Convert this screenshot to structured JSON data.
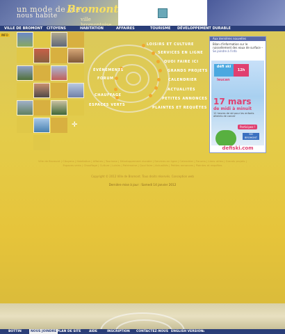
{
  "header": {
    "tagline_line1": "un mode de vie",
    "tagline_line2": "nous habite",
    "brand": "Bromont",
    "brand_sub": "ville   bromontoise"
  },
  "top_nav": [
    "Ville de Bromont",
    "Citoyens",
    "Habitation",
    "Affaires",
    "Tourisme",
    "Développement durable"
  ],
  "info_tag": "INFO",
  "spiral_menu": [
    "Loisirs et culture",
    "Services en ligne",
    "Quoi faire ici",
    "Grands projets",
    "Calendrier",
    "Actualités",
    "Petites annonces",
    "Plaintes et requêtes",
    "Espaces verts",
    "Chauffage",
    "Forum",
    "Événements"
  ],
  "ad_panel": {
    "header": "Aux dernières nouvelles",
    "news_text": "Bilan d'information sur le ruissellement des eaux de surface",
    "news_link": "Se joindre à l'info",
    "logo_left": "défi ski",
    "logo_right": "12h",
    "logo_brand": "leucan",
    "date": "17 mars",
    "sub": "de midi à minuit",
    "desc": "12 heures de ski pour les enfants atteints de cancer",
    "cta": "Participez !",
    "town": "SKI BROMONT",
    "footer": "defiski.com"
  },
  "footer_links": "Ville de Bromont | Citoyens | Habitation | Affaires | Tourisme | Développement durable | Services en ligne | Calendrier | Forums | Liens utiles | Grands projets | Espaces verts | Chauffage | Culture | Loisirs | Patrimoine | Quoi faire | Actualités | Petites annonces | Plaintes et requêtes",
  "credits": "Copyright © 2012 Ville de Bromont. Tous droits réservés. Conception web",
  "updated": "Dernière mise à jour : Samedi 14 janvier 2012",
  "bottom_nav": [
    "Bottin",
    "Nous joindre",
    "Plan de site",
    "Aide",
    "Inscription",
    "Contactez-nous",
    "English version"
  ],
  "colors": {
    "nav_bg": "#2a3e78",
    "accent": "#f0a830",
    "background": "#e4cc4a"
  }
}
